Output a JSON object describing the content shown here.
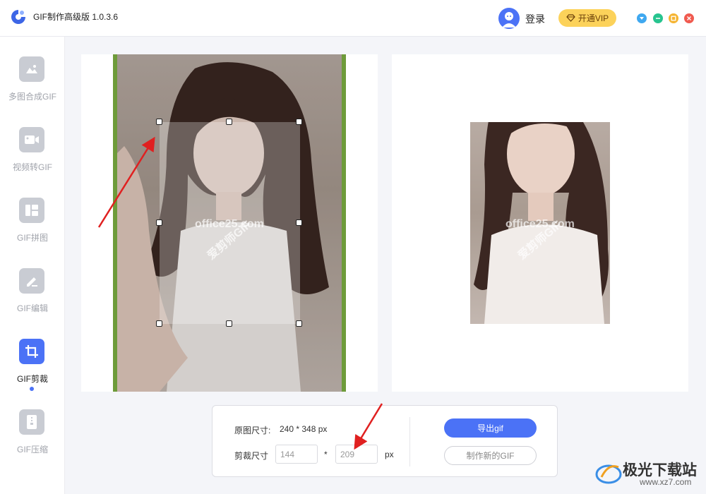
{
  "app": {
    "title": "GIF制作高级版 1.0.3.6"
  },
  "header": {
    "login_label": "登录",
    "vip_label": "开通VIP"
  },
  "window_controls": [
    {
      "icon": "minimize-tray-icon",
      "color": "#3fa8f0"
    },
    {
      "icon": "minimize-icon",
      "color": "#27c48f"
    },
    {
      "icon": "maximize-icon",
      "color": "#f5b431"
    },
    {
      "icon": "close-icon",
      "color": "#f05a4f"
    }
  ],
  "sidebar": {
    "items": [
      {
        "label": "多图合成GIF",
        "icon": "image-stack-icon",
        "active": false
      },
      {
        "label": "视频转GIF",
        "icon": "video-icon",
        "active": false
      },
      {
        "label": "GIF拼图",
        "icon": "collage-icon",
        "active": false
      },
      {
        "label": "GIF编辑",
        "icon": "edit-pen-icon",
        "active": false
      },
      {
        "label": "GIF剪裁",
        "icon": "crop-icon",
        "active": true
      },
      {
        "label": "GIF压缩",
        "icon": "compress-icon",
        "active": false
      }
    ]
  },
  "image": {
    "watermark_brand": "爱剪师GIF",
    "watermark_site": "office25.com"
  },
  "settings": {
    "original_size_label": "原图尺寸:",
    "original_size_value": "240 * 348 px",
    "crop_size_label": "剪裁尺寸",
    "crop_width": "144",
    "crop_separator": "*",
    "crop_height": "209",
    "crop_unit": "px",
    "export_label": "导出gif",
    "new_gif_label": "制作新的GIF"
  },
  "site_watermark": {
    "name": "极光下载站",
    "url": "www.xz7.com"
  },
  "colors": {
    "accent": "#4b72f6",
    "vip": "#fcd25a",
    "arrow": "#e02020"
  }
}
